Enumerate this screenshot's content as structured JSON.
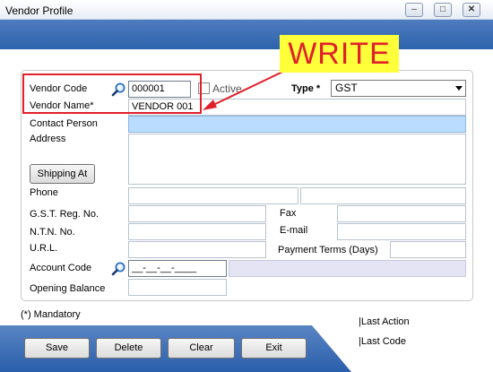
{
  "window": {
    "title": "Vendor Profile",
    "minimize_symbol": "–",
    "maximize_symbol": "□",
    "close_symbol": "✕"
  },
  "annotation": {
    "label": "WRITE",
    "label_color": "#e0202a",
    "label_background": "#ffff3a"
  },
  "form": {
    "vendor_code": {
      "label": "Vendor Code",
      "value": "000001"
    },
    "active": {
      "label": "Active",
      "checked": false
    },
    "type": {
      "label": "Type *",
      "value": "GST"
    },
    "vendor_name": {
      "label": "Vendor Name*",
      "value": "VENDOR 001"
    },
    "contact_person": {
      "label": "Contact Person",
      "value": ""
    },
    "address": {
      "label": "Address",
      "value": ""
    },
    "shipping_button": {
      "label": "Shipping At"
    },
    "phone": {
      "label": "Phone",
      "value": "",
      "value2": ""
    },
    "gst_reg_no": {
      "label": "G.S.T. Reg. No.",
      "value": ""
    },
    "fax": {
      "label": "Fax",
      "value": ""
    },
    "ntn_no": {
      "label": "N.T.N. No.",
      "value": ""
    },
    "email": {
      "label": "E-mail",
      "value": ""
    },
    "url": {
      "label": "U.R.L.",
      "value": ""
    },
    "payment_terms": {
      "label": "Payment Terms (Days)",
      "value": ""
    },
    "account_code": {
      "label": "Account Code",
      "value": "__-__-__-____",
      "description": ""
    },
    "opening_balance": {
      "label": "Opening Balance",
      "value": ""
    }
  },
  "footer": {
    "mandatory_note": "(*) Mandatory",
    "last_action": "|Last Action",
    "last_code": "|Last Code"
  },
  "buttons": {
    "save": "Save",
    "delete": "Delete",
    "clear": "Clear",
    "exit": "Exit"
  },
  "colors": {
    "band_blue": "#2d63ad",
    "highlight_red": "#e0202a",
    "contact_field_blue": "#b9dcff",
    "account_desc_lavender": "#e4e4f5"
  }
}
